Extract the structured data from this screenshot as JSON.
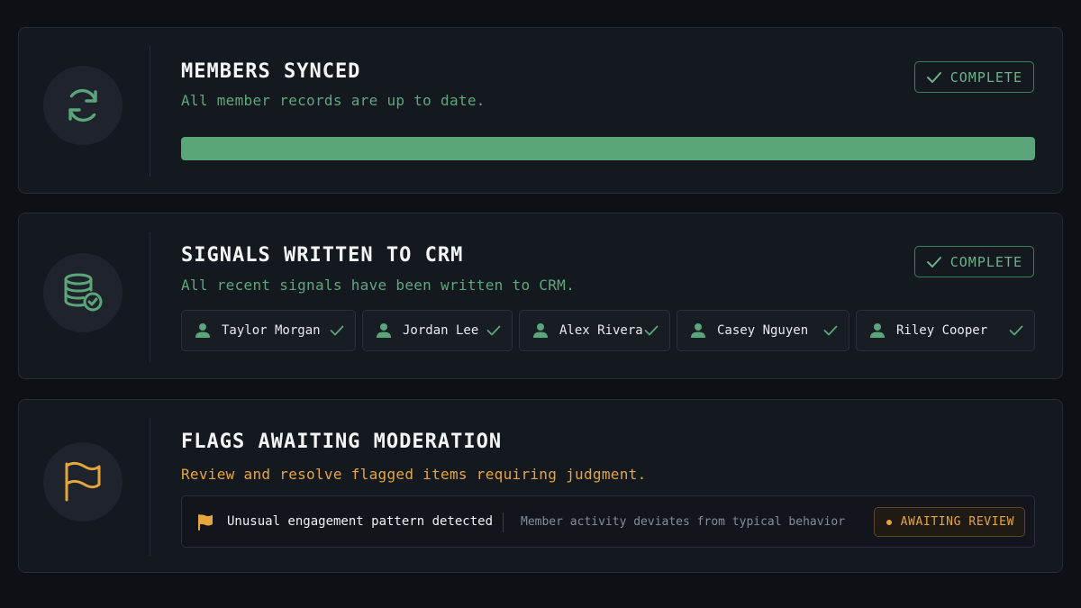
{
  "colors": {
    "background": "#0d1015",
    "card": "#14181f",
    "success": "#5ba57a",
    "warning": "#e5a63e",
    "muted_text": "#858c96"
  },
  "members_synced": {
    "icon": "sync-icon",
    "title": "MEMBERS SYNCED",
    "subtitle": "All member records are up to date.",
    "status": "COMPLETE",
    "status_icon": "check-icon",
    "progress_fraction": 1.0
  },
  "signals": {
    "icon": "database-check-icon",
    "title": "SIGNALS WRITTEN TO CRM",
    "subtitle": "All recent signals have been written to CRM.",
    "status": "COMPLETE",
    "status_icon": "check-icon",
    "members": [
      {
        "name": "Taylor Morgan",
        "icon": "user-icon",
        "status_icon": "check-icon"
      },
      {
        "name": "Jordan Lee",
        "icon": "user-icon",
        "status_icon": "check-icon"
      },
      {
        "name": "Alex Rivera",
        "icon": "user-icon",
        "status_icon": "check-icon"
      },
      {
        "name": "Casey Nguyen",
        "icon": "user-icon",
        "status_icon": "check-icon"
      },
      {
        "name": "Riley Cooper",
        "icon": "user-icon",
        "status_icon": "check-icon"
      }
    ]
  },
  "flags": {
    "icon": "flag-icon",
    "title": "FLAGS AWAITING MODERATION",
    "subtitle": "Review and resolve flagged items requiring judgment.",
    "items": [
      {
        "title": "Unusual engagement pattern detected",
        "description": "Member activity deviates from typical behavior",
        "status": "AWAITING REVIEW"
      }
    ]
  }
}
